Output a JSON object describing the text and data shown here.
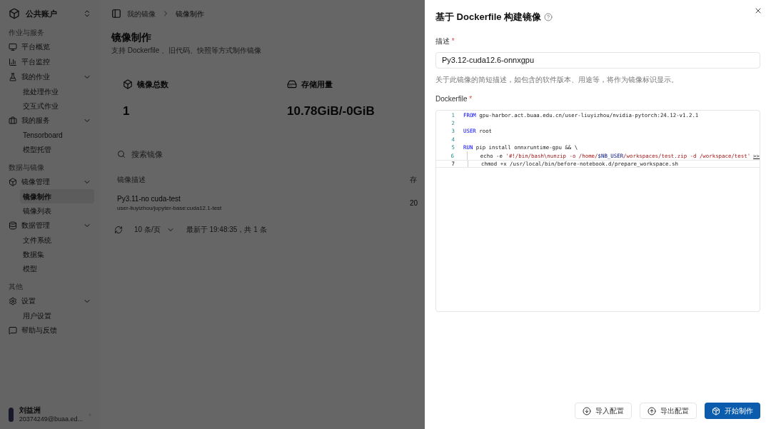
{
  "sidebar": {
    "account": "公共账户",
    "sections": [
      {
        "title": "作业与服务",
        "items": [
          {
            "label": "平台概览"
          },
          {
            "label": "平台监控"
          },
          {
            "label": "我的作业",
            "expanded": true,
            "children": [
              {
                "label": "批处理作业",
                "selected": false
              },
              {
                "label": "交互式作业",
                "selected": false
              }
            ]
          },
          {
            "label": "我的服务",
            "expanded": true,
            "children": [
              {
                "label": "Tensorboard",
                "selected": false
              },
              {
                "label": "模型托管",
                "selected": false
              }
            ]
          }
        ]
      },
      {
        "title": "数据与镜像",
        "items": [
          {
            "label": "镜像管理",
            "expanded": true,
            "children": [
              {
                "label": "镜像制作",
                "selected": true
              },
              {
                "label": "镜像列表",
                "selected": false
              }
            ]
          },
          {
            "label": "数据管理",
            "expanded": true,
            "children": [
              {
                "label": "文件系统",
                "selected": false
              },
              {
                "label": "数据集",
                "selected": false
              },
              {
                "label": "模型",
                "selected": false
              }
            ]
          }
        ]
      },
      {
        "title": "其他",
        "items": [
          {
            "label": "设置",
            "expanded": true,
            "children": [
              {
                "label": "用户设置",
                "selected": false
              }
            ]
          },
          {
            "label": "帮助与反馈"
          }
        ]
      }
    ],
    "user": {
      "name": "刘益洲",
      "email": "20374249@buaa.ed..."
    }
  },
  "breadcrumb": [
    "我的镜像",
    "镜像制作"
  ],
  "page": {
    "title": "镜像制作",
    "subtitle": "支持 Dockerfile 、旧代码、快照等方式制作镜像",
    "stats": [
      {
        "label": "镜像总数",
        "value": "1"
      },
      {
        "label": "存储用量",
        "value": "10.78GiB/-0GiB"
      }
    ],
    "search": {
      "placeholder": "搜索镜像"
    },
    "table": {
      "columns": [
        "镜像描述",
        "存"
      ],
      "rows": [
        {
          "title": "Py3.11-no cuda-test",
          "subtitle": "user-liuyizhou/jupyter-base:cuda12.1-test",
          "column_2": "20"
        }
      ]
    },
    "pagination": {
      "page_size": "10 条/页",
      "status": "最新于 19:48:35，共 1 条"
    }
  },
  "drawer": {
    "title": "基于 Dockerfile 构建镜像",
    "description": {
      "label": "描述",
      "required": "*",
      "value": "Py3.12-cuda12.6-onnxgpu",
      "hint": "关于此镜像的简短描述，如包含的软件版本、用途等，将作为镜像标识显示。"
    },
    "dockerfile": {
      "label": "Dockerfile",
      "required": "*",
      "lines": [
        {
          "number": "1",
          "current": false,
          "indent": false,
          "tokens": [
            {
              "kind": "keyword",
              "text": "FROM"
            },
            {
              "kind": "plain",
              "text": " gpu-harbor.act.buaa.edu.cn/user-liuyizhou/nvidia-pytorch:24.12-v1.2.1"
            }
          ]
        },
        {
          "number": "2",
          "current": false,
          "indent": false
        },
        {
          "number": "3",
          "current": false,
          "indent": false,
          "tokens": [
            {
              "kind": "keyword",
              "text": "USER"
            },
            {
              "kind": "plain",
              "text": " root"
            }
          ]
        },
        {
          "number": "4",
          "current": false,
          "indent": false
        },
        {
          "number": "5",
          "current": false,
          "indent": false,
          "tokens": [
            {
              "kind": "keyword",
              "text": "RUN"
            },
            {
              "kind": "plain",
              "text": " pip install onnxruntime-gpu && \\"
            }
          ]
        },
        {
          "number": "6",
          "current": false,
          "indent": true,
          "tokens": [
            {
              "kind": "plain",
              "text": "echo -e "
            },
            {
              "kind": "string",
              "text": "'#!/bin/bash\\nunzip -o /home/"
            },
            {
              "kind": "variable",
              "text": "$NB_USER"
            },
            {
              "kind": "string",
              "text": "/workspaces/test.zip -d /workspace/test'"
            },
            {
              "kind": "overflow",
              "text": ">>"
            }
          ]
        },
        {
          "number": "7",
          "current": true,
          "indent": true,
          "tokens": [
            {
              "kind": "plain",
              "text": "chmod +x /usr/local/bin/before-notebook.d/prepare_workspace.sh"
            }
          ]
        }
      ]
    },
    "buttons": [
      {
        "label": "导入配置",
        "kind": "secondary"
      },
      {
        "label": "导出配置",
        "kind": "secondary"
      },
      {
        "label": "开始制作",
        "kind": "primary"
      }
    ]
  }
}
